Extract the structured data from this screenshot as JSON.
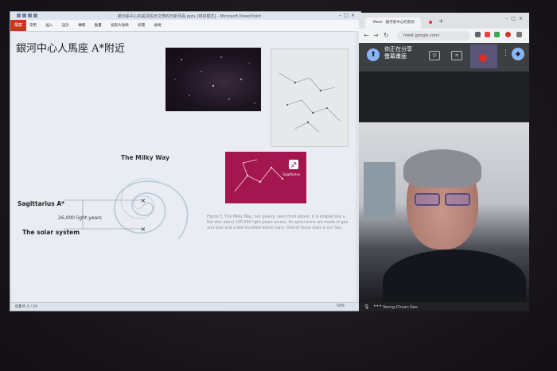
{
  "ppt": {
    "window_title": "銀河系中心的黑洞與天文學的日新月異.pptx [相容模式] - Microsoft PowerPoint",
    "file_tab": "檔案",
    "ribbon_tabs": [
      "常用",
      "插入",
      "設計",
      "轉場",
      "動畫",
      "投影片放映",
      "校閱",
      "檢視"
    ],
    "slide": {
      "title": "銀河中心人馬座 A*附近",
      "milky_way_title": "The Milky Way",
      "sagittarius_label": "Sagittarius A*",
      "distance_label": "26,000 light-years",
      "solar_system_label": "The solar system",
      "sagittarius_icon_label": "Sagittarius",
      "caption": "Figure 3. The Milky Way, our galaxy, seen from above. It is shaped like a flat disc about 100,000 light-years across. Its spiral arms are made of gas and dust and a few hundred billion stars. One of these stars is our Sun."
    },
    "status_left": "投影片 2 / 24",
    "status_right": "50%"
  },
  "meet": {
    "tab_title": "Meet - 銀河系中心的黑洞",
    "url": "meet.google.com/",
    "share_line1": "你正在分享",
    "share_line2": "螢幕畫面",
    "participant_name": "Yeong-Chuan Kao"
  },
  "colors": {
    "ppt_file_tab": "#c8381e",
    "meet_accent": "#8ab4f8",
    "sag_card": "#a31650"
  }
}
